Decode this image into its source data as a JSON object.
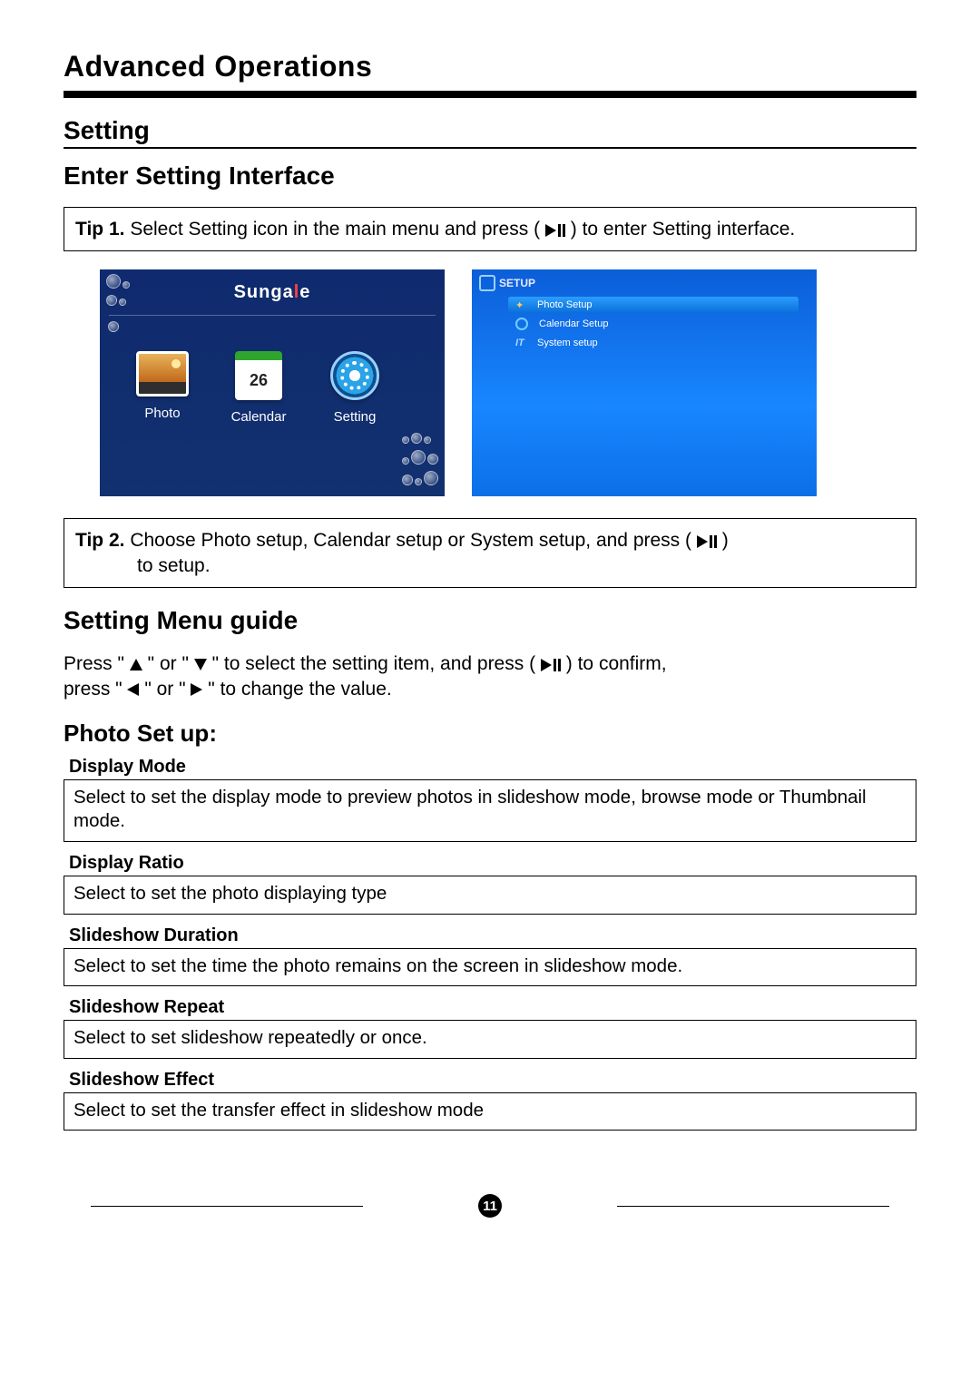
{
  "chapter": "Advanced Operations",
  "section": "Setting",
  "subsection": "Enter Setting Interface",
  "tip1": {
    "label": "Tip 1.",
    "text_a": "Select Setting icon in the main menu and press (",
    "text_b": ") to enter Setting interface."
  },
  "frame_menu": {
    "brand_a": "Sunga",
    "brand_b": "l",
    "brand_c": "e",
    "items": [
      {
        "label": "Photo"
      },
      {
        "label": "Calendar",
        "day": "26"
      },
      {
        "label": "Setting"
      }
    ]
  },
  "setup_screen": {
    "title": "SETUP",
    "rows": [
      {
        "icon": "star",
        "label": "Photo Setup",
        "selected": true
      },
      {
        "icon": "circ",
        "label": "Calendar Setup",
        "selected": false
      },
      {
        "icon": "it",
        "label": "System setup",
        "selected": false
      }
    ]
  },
  "tip2": {
    "label": "Tip 2.",
    "text_a": "Choose Photo setup, Calendar setup or System setup, and press (",
    "text_b": ")",
    "text_c": "to setup."
  },
  "menuguide": {
    "title": "Setting Menu guide",
    "a": "Press \"",
    "b": "\" or \"",
    "c": "\" to select the setting item, and press (",
    "d": ") to confirm,",
    "e": "press \"",
    "f": "\" or \"",
    "g": "\" to change the value."
  },
  "photosetup": {
    "title": "Photo Set up:",
    "options": [
      {
        "name": "Display Mode",
        "desc": "Select to set the display mode to preview photos in slideshow mode, browse mode or Thumbnail mode."
      },
      {
        "name": "Display Ratio",
        "desc": "Select to set the photo displaying type"
      },
      {
        "name": "Slideshow Duration",
        "desc": "Select to set the time the photo remains on the screen in slideshow mode."
      },
      {
        "name": "Slideshow Repeat",
        "desc": "Select to set slideshow repeatedly or once."
      },
      {
        "name": "Slideshow Effect",
        "desc": "Select to set the transfer effect in slideshow mode"
      }
    ]
  },
  "page_number": "11"
}
